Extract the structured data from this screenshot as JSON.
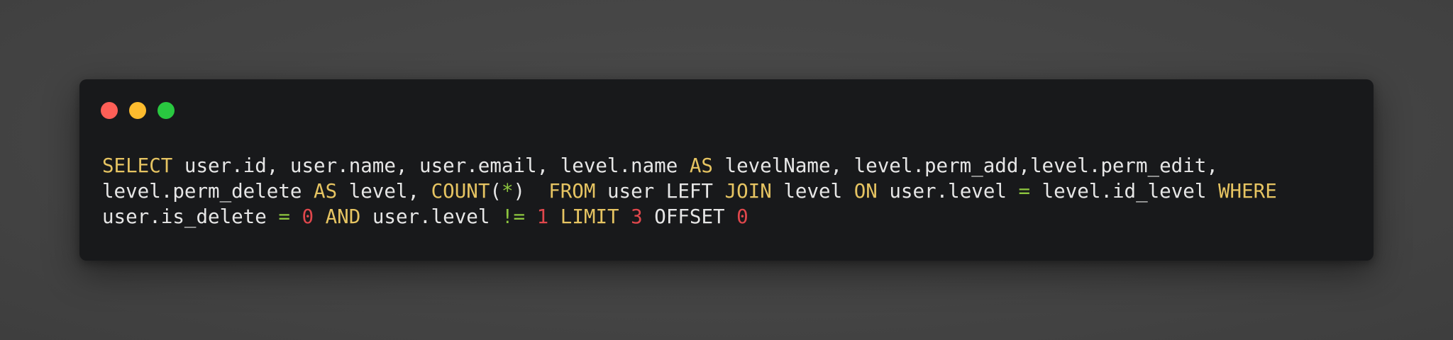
{
  "window": {
    "buttons": [
      {
        "name": "close",
        "color": "#fe5f57"
      },
      {
        "name": "minimize",
        "color": "#febc2e"
      },
      {
        "name": "maximize",
        "color": "#29c840"
      }
    ]
  },
  "colors": {
    "background": "#474747",
    "window": "#18191b",
    "text": "#e6e6e6",
    "keyword": "#e6c462",
    "operator": "#8dc63f",
    "number": "#e0474c"
  },
  "code": {
    "language": "sql",
    "lines": [
      [
        {
          "t": "SELECT",
          "c": "keyword"
        },
        {
          "t": " user.id, user.name, user.email, level.name ",
          "c": "text"
        },
        {
          "t": "AS",
          "c": "keyword"
        },
        {
          "t": " levelName, level.perm_add,level.perm_edit,",
          "c": "text"
        }
      ],
      [
        {
          "t": "level.perm_delete ",
          "c": "text"
        },
        {
          "t": "AS",
          "c": "keyword"
        },
        {
          "t": " level, ",
          "c": "text"
        },
        {
          "t": "COUNT",
          "c": "keyword"
        },
        {
          "t": "(",
          "c": "text"
        },
        {
          "t": "*",
          "c": "operator"
        },
        {
          "t": ")  ",
          "c": "text"
        },
        {
          "t": "FROM",
          "c": "keyword"
        },
        {
          "t": " user LEFT ",
          "c": "text"
        },
        {
          "t": "JOIN",
          "c": "keyword"
        },
        {
          "t": " level ",
          "c": "text"
        },
        {
          "t": "ON",
          "c": "keyword"
        },
        {
          "t": " user.level ",
          "c": "text"
        },
        {
          "t": "=",
          "c": "operator"
        },
        {
          "t": " level.id_level ",
          "c": "text"
        },
        {
          "t": "WHERE",
          "c": "keyword"
        }
      ],
      [
        {
          "t": "user.is_delete ",
          "c": "text"
        },
        {
          "t": "=",
          "c": "operator"
        },
        {
          "t": " ",
          "c": "text"
        },
        {
          "t": "0",
          "c": "number"
        },
        {
          "t": " ",
          "c": "text"
        },
        {
          "t": "AND",
          "c": "keyword"
        },
        {
          "t": " user.level ",
          "c": "text"
        },
        {
          "t": "!=",
          "c": "operator"
        },
        {
          "t": " ",
          "c": "text"
        },
        {
          "t": "1",
          "c": "number"
        },
        {
          "t": " ",
          "c": "text"
        },
        {
          "t": "LIMIT",
          "c": "keyword"
        },
        {
          "t": " ",
          "c": "text"
        },
        {
          "t": "3",
          "c": "number"
        },
        {
          "t": " OFFSET ",
          "c": "text"
        },
        {
          "t": "0",
          "c": "number"
        }
      ]
    ]
  }
}
